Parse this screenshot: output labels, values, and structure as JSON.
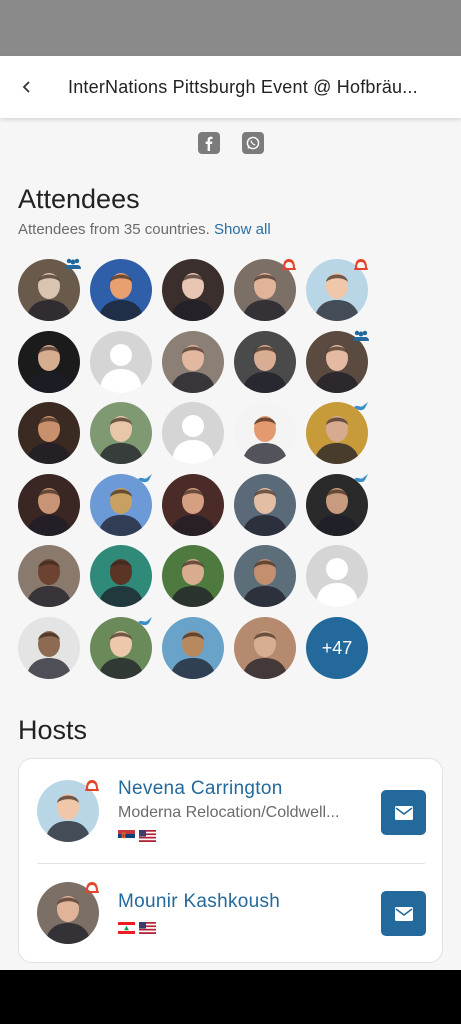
{
  "app_bar": {
    "title": "InterNations Pittsburgh Event @ Hofbräu..."
  },
  "share": {
    "icons": [
      "facebook-icon",
      "whatsapp-icon"
    ]
  },
  "attendees": {
    "title": "Attendees",
    "subtitle": "Attendees from 35 countries.",
    "show_all": "Show all",
    "more_count": "+47",
    "avatars": [
      {
        "bg": "#6a5a4c",
        "fg": "#d8c4b0",
        "badge": "group"
      },
      {
        "bg": "#2f5fa8",
        "fg": "#e8a070",
        "badge": ""
      },
      {
        "bg": "#3a2f2c",
        "fg": "#e9c6b4",
        "badge": ""
      },
      {
        "bg": "#7b6f66",
        "fg": "#e1b49a",
        "badge": "ambassador"
      },
      {
        "bg": "#b9d6e6",
        "fg": "#f0c7a8",
        "badge": "ambassador"
      },
      {
        "bg": "#1b1b1b",
        "fg": "#d7ad90",
        "badge": ""
      },
      {
        "bg": "#d5d5d5",
        "fg": "#ffffff",
        "badge": "",
        "placeholder": true
      },
      {
        "bg": "#8c7f76",
        "fg": "#e2b8a0",
        "badge": ""
      },
      {
        "bg": "#4a4a4a",
        "fg": "#d9ad93",
        "badge": ""
      },
      {
        "bg": "#5b4a3f",
        "fg": "#e4bba2",
        "badge": "group"
      },
      {
        "bg": "#3a2a22",
        "fg": "#c8906c",
        "badge": ""
      },
      {
        "bg": "#7f9a73",
        "fg": "#e8c6a8",
        "badge": ""
      },
      {
        "bg": "#d5d5d5",
        "fg": "#ffffff",
        "badge": "",
        "placeholder": true
      },
      {
        "bg": "#f4f4f4",
        "fg": "#e39a6e",
        "badge": ""
      },
      {
        "bg": "#c79a3a",
        "fg": "#d6ab90",
        "badge": "bird"
      },
      {
        "bg": "#3a2623",
        "fg": "#c99476",
        "badge": ""
      },
      {
        "bg": "#6b9ad6",
        "fg": "#c8a060",
        "badge": "bird"
      },
      {
        "bg": "#4b2b27",
        "fg": "#d79f82",
        "badge": ""
      },
      {
        "bg": "#5a6a78",
        "fg": "#e3bea4",
        "badge": ""
      },
      {
        "bg": "#2a2a2a",
        "fg": "#c89a7e",
        "badge": "bird"
      },
      {
        "bg": "#8a7a6e",
        "fg": "#6b4330",
        "badge": ""
      },
      {
        "bg": "#2f8a7a",
        "fg": "#5a3424",
        "badge": ""
      },
      {
        "bg": "#4f7a3f",
        "fg": "#d8ac8e",
        "badge": ""
      },
      {
        "bg": "#5b6e7a",
        "fg": "#c48f6e",
        "badge": ""
      },
      {
        "bg": "#d5d5d5",
        "fg": "#ffffff",
        "badge": "",
        "placeholder": true
      },
      {
        "bg": "#e4e4e4",
        "fg": "#8c6b52",
        "badge": ""
      },
      {
        "bg": "#6b8a5a",
        "fg": "#edc8ac",
        "badge": "bird"
      },
      {
        "bg": "#6aa3c9",
        "fg": "#b8885e",
        "badge": ""
      },
      {
        "bg": "#b58a6e",
        "fg": "#d8ae92",
        "badge": ""
      }
    ]
  },
  "hosts": {
    "title": "Hosts",
    "items": [
      {
        "name": "Nevena Carrington",
        "org": "Moderna Relocation/Coldwell...",
        "flags": [
          "serbia",
          "usa"
        ],
        "bg": "#b9d6e6",
        "fg": "#f0c7a8"
      },
      {
        "name": "Mounir Kashkoush",
        "org": "",
        "flags": [
          "lebanon",
          "usa"
        ],
        "bg": "#7b6f66",
        "fg": "#e1b49a"
      }
    ]
  },
  "colors": {
    "accent": "#23699b",
    "ambassador_badge": "#e2452b",
    "group_badge": "#23699b"
  }
}
